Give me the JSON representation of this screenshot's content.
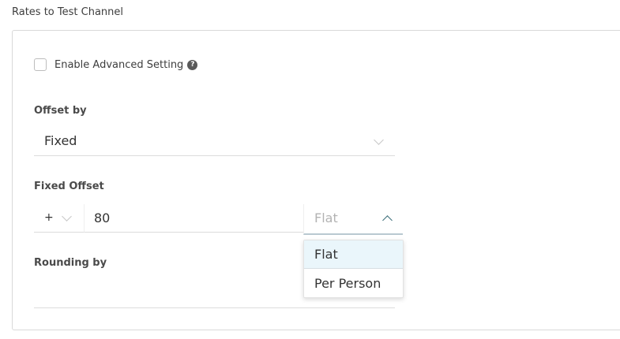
{
  "section_title": "Rates to Test Channel",
  "advanced": {
    "label": "Enable Advanced Setting",
    "checked": false,
    "help_icon": "?"
  },
  "offset_by": {
    "label": "Offset by",
    "value": "Fixed"
  },
  "fixed_offset": {
    "label": "Fixed Offset",
    "sign": "+",
    "amount": "80",
    "type_value": "Flat",
    "options": [
      "Flat",
      "Per Person"
    ]
  },
  "rounding_by": {
    "label": "Rounding by"
  }
}
